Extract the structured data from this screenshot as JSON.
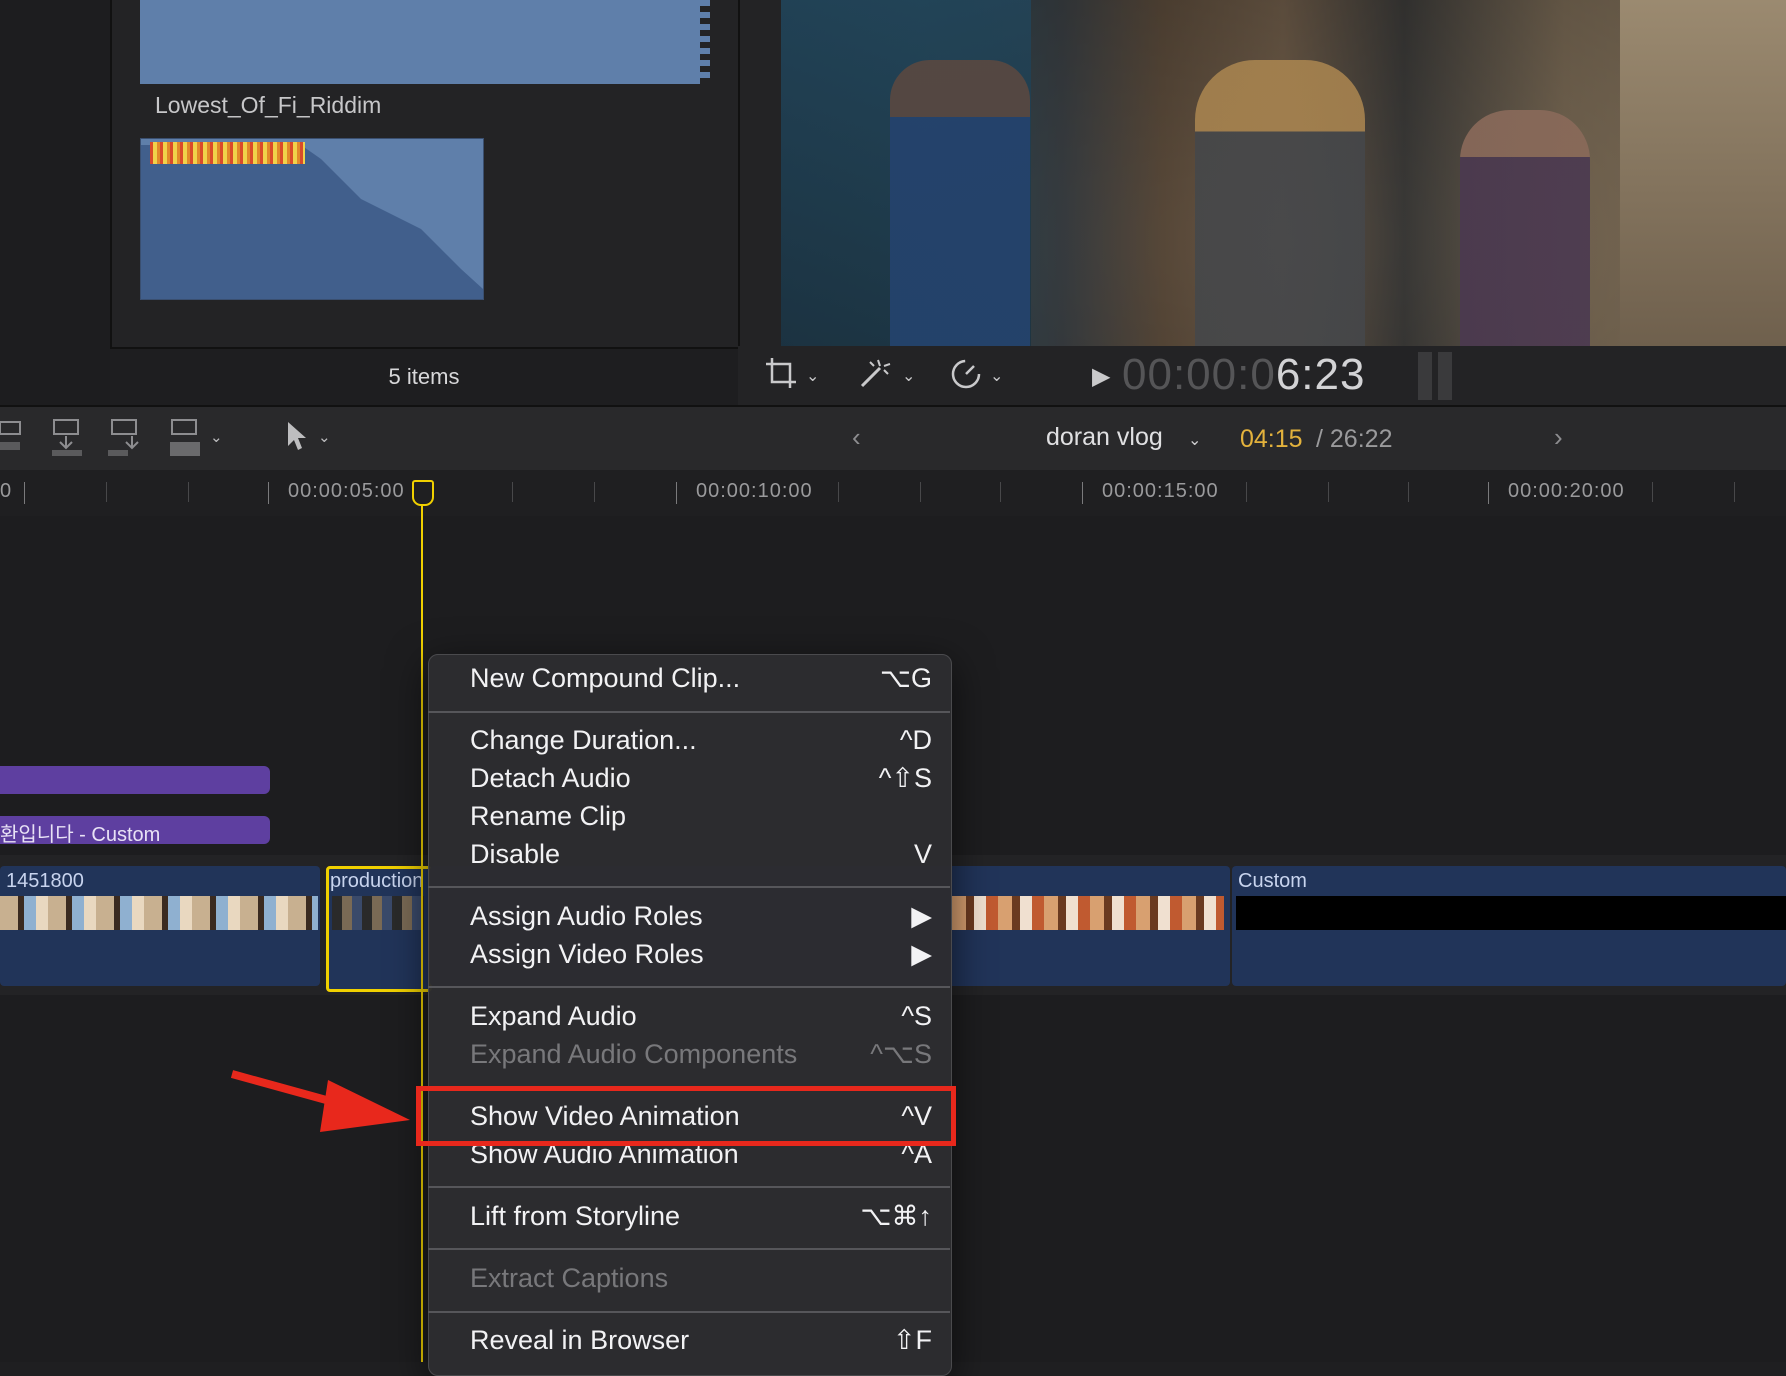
{
  "browser": {
    "clip_name": "Lowest_Of_Fi_Riddim",
    "items_count": "5 items"
  },
  "viewer": {
    "timecode_dim": "00:00:0",
    "timecode_bright": "6:23",
    "tool_icons": [
      "crop-icon",
      "magic-wand-icon",
      "speed-icon"
    ]
  },
  "timeline_toolbar": {
    "project_name": "doran vlog",
    "current_time": "04:15",
    "separator": " / ",
    "total_time": "26:22"
  },
  "ruler": {
    "labels": [
      "0",
      "00:00:05:00",
      "00:00:10:00",
      "00:00:15:00",
      "00:00:20:00"
    ]
  },
  "timeline": {
    "title_label": "환입니다 - Custom",
    "clips": [
      {
        "label": "1451800"
      },
      {
        "label": "production"
      },
      {
        "label": ""
      },
      {
        "label": "Custom"
      }
    ]
  },
  "context_menu": {
    "items": [
      {
        "label": "New Compound Clip...",
        "shortcut": "⌥G",
        "enabled": true
      },
      {
        "label": "Change Duration...",
        "shortcut": "^D",
        "enabled": true
      },
      {
        "label": "Detach Audio",
        "shortcut": "^⇧S",
        "enabled": true
      },
      {
        "label": "Rename Clip",
        "shortcut": "",
        "enabled": true
      },
      {
        "label": "Disable",
        "shortcut": "V",
        "enabled": true
      },
      {
        "label": "Assign Audio Roles",
        "shortcut": "▶",
        "enabled": true
      },
      {
        "label": "Assign Video Roles",
        "shortcut": "▶",
        "enabled": true
      },
      {
        "label": "Expand Audio",
        "shortcut": "^S",
        "enabled": true
      },
      {
        "label": "Expand Audio Components",
        "shortcut": "^⌥S",
        "enabled": false
      },
      {
        "label": "Show Video Animation",
        "shortcut": "^V",
        "enabled": true,
        "highlighted": true
      },
      {
        "label": "Show Audio Animation",
        "shortcut": "^A",
        "enabled": true
      },
      {
        "label": "Lift from Storyline",
        "shortcut": "⌥⌘↑",
        "enabled": true
      },
      {
        "label": "Extract Captions",
        "shortcut": "",
        "enabled": false
      },
      {
        "label": "Reveal in Browser",
        "shortcut": "⇧F",
        "enabled": true
      }
    ]
  },
  "colors": {
    "playhead": "#f0d000",
    "annotation": "#e8281c",
    "timecode_current": "#e3b23c",
    "clip_blue": "#213459",
    "title_purple": "#5e3fa0"
  }
}
